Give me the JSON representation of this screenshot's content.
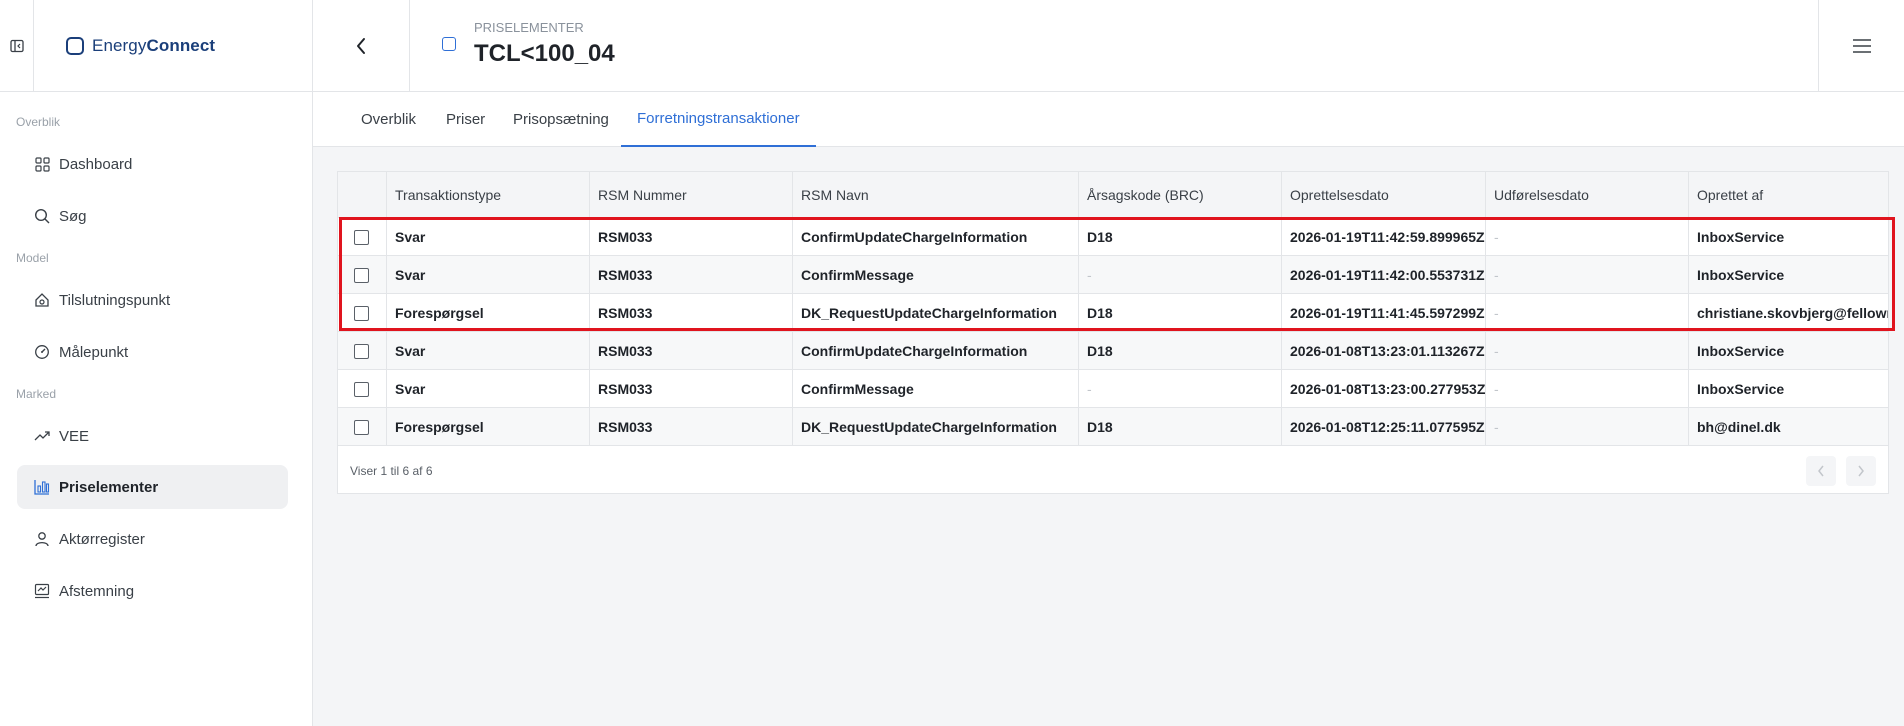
{
  "app": {
    "brand_prefix": "Energy",
    "brand_suffix": "Connect"
  },
  "header": {
    "kicker": "PRISELEMENTER",
    "title": "TCL<100_04"
  },
  "sidebar": {
    "sections": [
      "Overblik",
      "Model",
      "Marked"
    ],
    "items": [
      {
        "label": "Dashboard",
        "icon": "grid-icon"
      },
      {
        "label": "Søg",
        "icon": "search-icon"
      },
      {
        "label": "Tilslutningspunkt",
        "icon": "house-plug-icon"
      },
      {
        "label": "Målepunkt",
        "icon": "gauge-icon"
      },
      {
        "label": "VEE",
        "icon": "trend-icon"
      },
      {
        "label": "Priselementer",
        "icon": "price-chart-icon",
        "active": true
      },
      {
        "label": "Aktørregister",
        "icon": "user-icon"
      },
      {
        "label": "Afstemning",
        "icon": "check-chart-icon"
      }
    ]
  },
  "tabs": [
    {
      "label": "Overblik"
    },
    {
      "label": "Priser"
    },
    {
      "label": "Prisopsætning"
    },
    {
      "label": "Forretningstransaktioner",
      "active": true
    }
  ],
  "table": {
    "columns": [
      "Transaktionstype",
      "RSM Nummer",
      "RSM Navn",
      "Årsagskode (BRC)",
      "Oprettelsesdato",
      "Udførelsesdato",
      "Oprettet af"
    ],
    "rows": [
      [
        "Svar",
        "RSM033",
        "ConfirmUpdateChargeInformation",
        "D18",
        "2026-01-19T11:42:59.899965Z",
        "-",
        "InboxService"
      ],
      [
        "Svar",
        "RSM033",
        "ConfirmMessage",
        "-",
        "2026-01-19T11:42:00.553731Z",
        "-",
        "InboxService"
      ],
      [
        "Forespørgsel",
        "RSM033",
        "DK_RequestUpdateChargeInformation",
        "D18",
        "2026-01-19T11:41:45.597299Z",
        "-",
        "christiane.skovbjerg@fellowmi"
      ],
      [
        "Svar",
        "RSM033",
        "ConfirmUpdateChargeInformation",
        "D18",
        "2026-01-08T13:23:01.113267Z",
        "-",
        "InboxService"
      ],
      [
        "Svar",
        "RSM033",
        "ConfirmMessage",
        "-",
        "2026-01-08T13:23:00.277953Z",
        "-",
        "InboxService"
      ],
      [
        "Forespørgsel",
        "RSM033",
        "DK_RequestUpdateChargeInformation",
        "D18",
        "2026-01-08T12:25:11.077595Z",
        "-",
        "bh@dinel.dk"
      ]
    ],
    "footer": "Viser 1 til 6 af 6"
  },
  "colors": {
    "accent": "#2f6fd6",
    "brand": "#1b3f7a",
    "highlight": "#e0141e"
  }
}
